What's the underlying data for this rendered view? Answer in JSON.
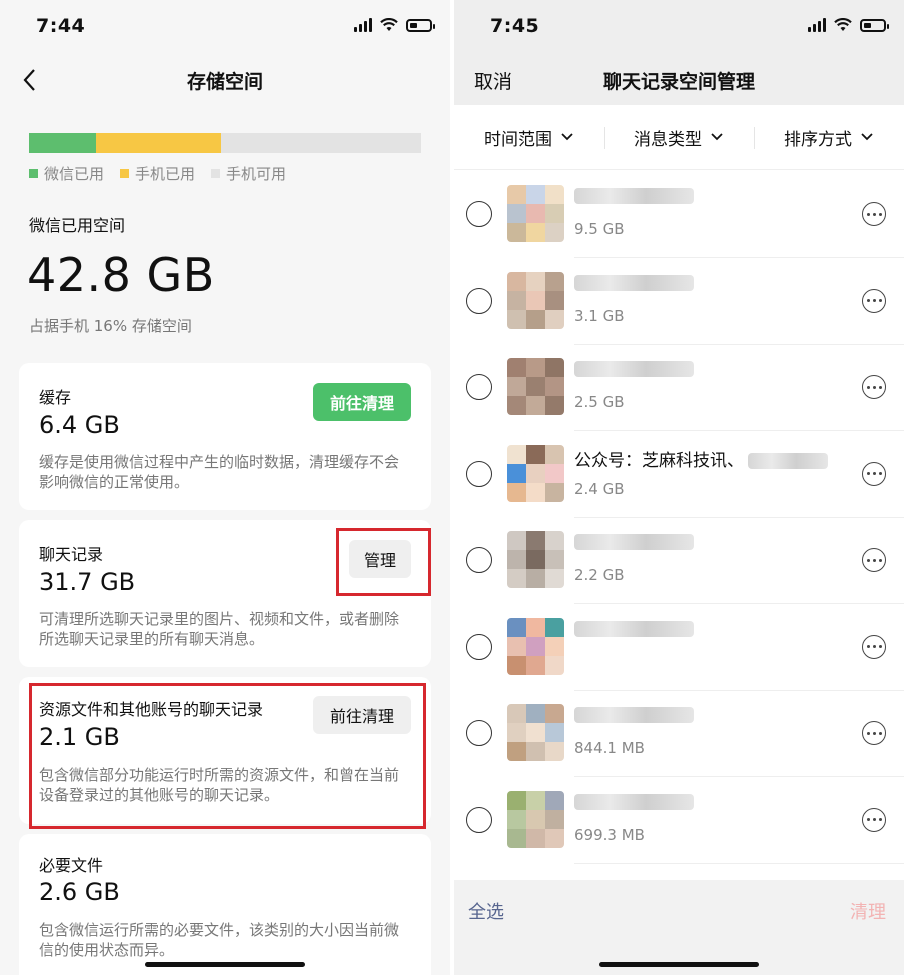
{
  "left": {
    "status": {
      "time": "7:44"
    },
    "nav": {
      "title": "存储空间"
    },
    "storage_bar": {
      "segments": [
        {
          "name": "wechat",
          "fraction": 0.17,
          "color": "#5dbe6e"
        },
        {
          "name": "phone",
          "fraction": 0.32,
          "color": "#f7c744"
        }
      ],
      "free_color": "#e3e3e3"
    },
    "legend": [
      {
        "label": "微信已用",
        "color": "#5dbe6e"
      },
      {
        "label": "手机已用",
        "color": "#f7c744"
      },
      {
        "label": "手机可用",
        "color": "#e3e3e3"
      }
    ],
    "used": {
      "label": "微信已用空间",
      "value": "42.8 GB",
      "note": "占据手机 16% 存储空间"
    },
    "cards": {
      "cache": {
        "label": "缓存",
        "size": "6.4 GB",
        "button": "前往清理",
        "desc": "缓存是使用微信过程中产生的临时数据，清理缓存不会影响微信的正常使用。"
      },
      "chat": {
        "label": "聊天记录",
        "size": "31.7 GB",
        "button": "管理",
        "desc": "可清理所选聊天记录里的图片、视频和文件，或者删除所选聊天记录里的所有聊天消息。"
      },
      "resources": {
        "label": "资源文件和其他账号的聊天记录",
        "size": "2.1 GB",
        "button": "前往清理",
        "desc": "包含微信部分功能运行时所需的资源文件，和曾在当前设备登录过的其他账号的聊天记录。"
      },
      "required": {
        "label": "必要文件",
        "size": "2.6 GB",
        "desc": "包含微信运行所需的必要文件，该类别的大小因当前微信的使用状态而异。"
      }
    }
  },
  "right": {
    "status": {
      "time": "7:45"
    },
    "nav": {
      "cancel": "取消",
      "title": "聊天记录空间管理"
    },
    "filters": [
      {
        "label": "时间范围"
      },
      {
        "label": "消息类型"
      },
      {
        "label": "排序方式"
      }
    ],
    "chats": [
      {
        "name": "",
        "size": "9.5 GB"
      },
      {
        "name": "",
        "size": "3.1 GB"
      },
      {
        "name": "",
        "size": "2.5 GB"
      },
      {
        "name": "公众号：芝麻科技讯、",
        "size": "2.4 GB"
      },
      {
        "name": "",
        "size": "2.2 GB"
      },
      {
        "name": "",
        "size": ""
      },
      {
        "name": "",
        "size": "844.1 MB"
      },
      {
        "name": "",
        "size": "699.3 MB"
      }
    ],
    "bottom": {
      "select_all": "全选",
      "clean": "清理"
    }
  }
}
